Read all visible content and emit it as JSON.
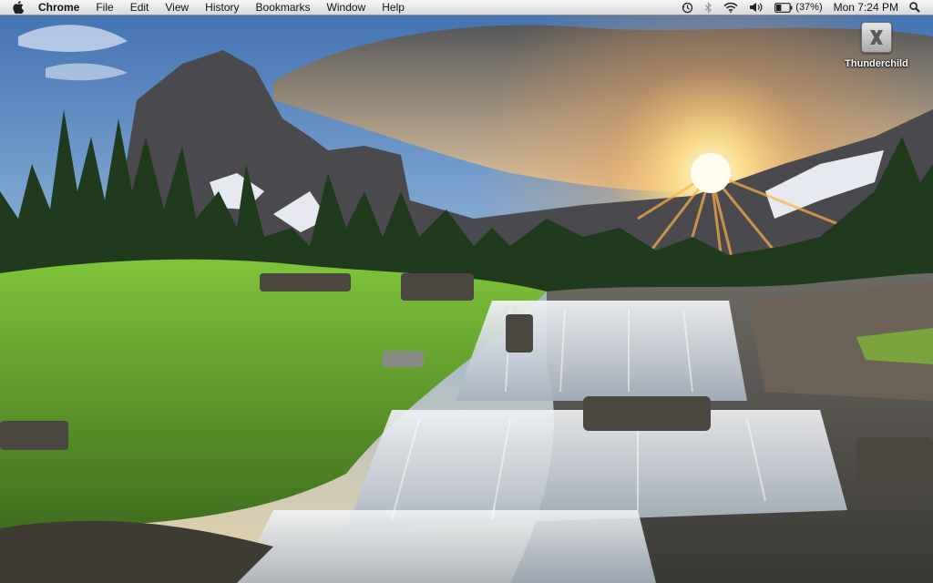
{
  "menubar": {
    "apple_icon": "apple-logo-icon",
    "app_name": "Chrome",
    "menus": [
      "File",
      "Edit",
      "View",
      "History",
      "Bookmarks",
      "Window",
      "Help"
    ],
    "status": {
      "time_machine_icon": "time-machine-icon",
      "bluetooth_icon": "bluetooth-icon",
      "wifi_icon": "wifi-icon",
      "volume_icon": "volume-icon",
      "battery_icon": "battery-icon",
      "battery_percent": "(37%)",
      "battery_level": 0.37,
      "clock": "Mon 7:24 PM",
      "spotlight_icon": "spotlight-search-icon"
    }
  },
  "desktop": {
    "wallpaper": "waterfall-mountain-sunset-photo",
    "icons": [
      {
        "label": "Thunderchild",
        "icon": "x-drive-icon"
      }
    ]
  }
}
